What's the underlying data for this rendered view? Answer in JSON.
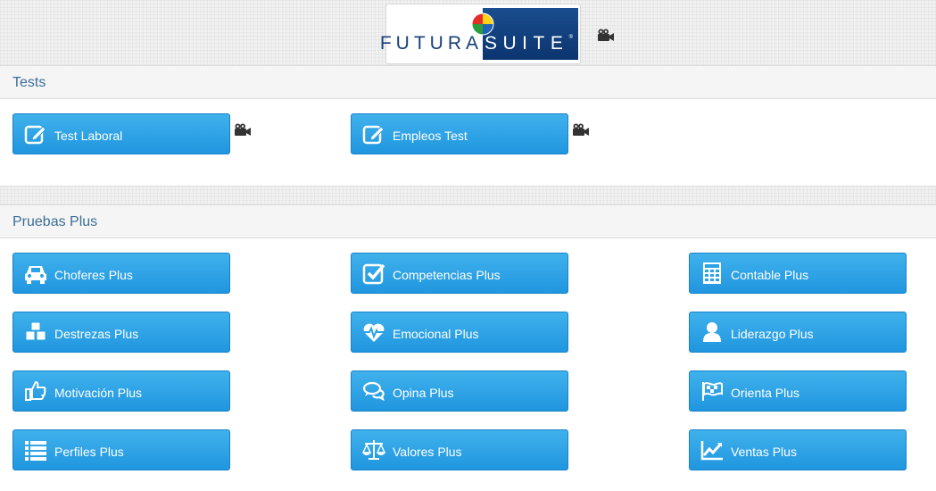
{
  "header": {
    "logo": {
      "text_left": "FUTURA",
      "text_right": "SUITE",
      "registered": "®"
    },
    "video_icon": "video-camera-icon"
  },
  "tests": {
    "title": "Tests",
    "buttons": [
      {
        "label": "Test Laboral",
        "icon": "edit-icon"
      },
      {
        "label": "Empleos Test",
        "icon": "edit-icon"
      }
    ]
  },
  "plus": {
    "title": "Pruebas Plus",
    "buttons": [
      {
        "label": "Choferes Plus",
        "icon": "car-icon"
      },
      {
        "label": "Competencias Plus",
        "icon": "check-square-icon"
      },
      {
        "label": "Contable Plus",
        "icon": "calculator-icon"
      },
      {
        "label": "Destrezas Plus",
        "icon": "cubes-icon"
      },
      {
        "label": "Emocional Plus",
        "icon": "heartbeat-icon"
      },
      {
        "label": "Liderazgo Plus",
        "icon": "user-icon"
      },
      {
        "label": "Motivación Plus",
        "icon": "thumbs-up-icon"
      },
      {
        "label": "Opina Plus",
        "icon": "comments-icon"
      },
      {
        "label": "Orienta Plus",
        "icon": "flag-icon"
      },
      {
        "label": "Perfiles Plus",
        "icon": "list-icon"
      },
      {
        "label": "Valores Plus",
        "icon": "balance-scale-icon"
      },
      {
        "label": "Ventas Plus",
        "icon": "line-chart-icon"
      }
    ]
  },
  "colors": {
    "button": "#2aa3e6",
    "heading": "#3d6e98",
    "logo_blue": "#173f7a"
  }
}
